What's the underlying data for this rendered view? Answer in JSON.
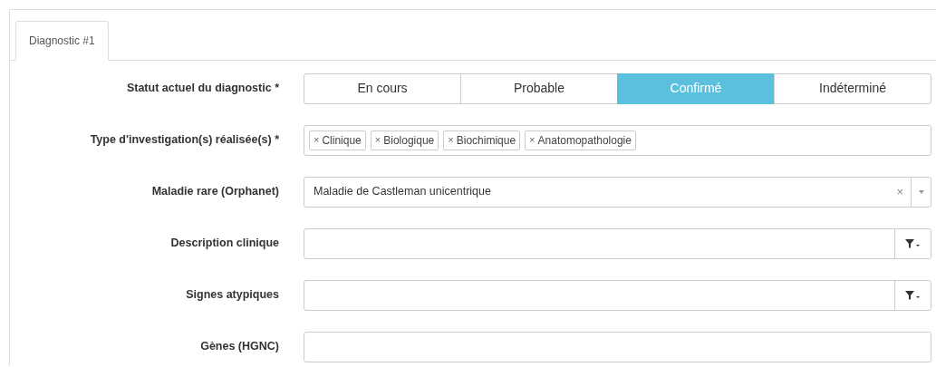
{
  "tabs": [
    {
      "label": "Diagnostic #1",
      "selected": true
    }
  ],
  "fields": [
    {
      "kind": "segmented",
      "label": "Statut actuel du diagnostic *",
      "options": [
        {
          "label": "En cours",
          "selected": false
        },
        {
          "label": "Probable",
          "selected": false
        },
        {
          "label": "Confirmé",
          "selected": true
        },
        {
          "label": "Indéterminé",
          "selected": false
        }
      ]
    },
    {
      "kind": "tags",
      "label": "Type d'investigation(s) réalisée(s) *",
      "tags": [
        {
          "remove": "×",
          "text": "Clinique"
        },
        {
          "remove": "×",
          "text": "Biologique"
        },
        {
          "remove": "×",
          "text": "Biochimique"
        },
        {
          "remove": "×",
          "text": "Anatomopathologie"
        }
      ]
    },
    {
      "kind": "select",
      "label": "Maladie rare (Orphanet)",
      "value": "Maladie de Castleman unicentrique",
      "clear": "×"
    },
    {
      "kind": "filter",
      "label": "Description clinique"
    },
    {
      "kind": "filter",
      "label": "Signes atypiques"
    },
    {
      "kind": "text",
      "label": "Gènes (HGNC)"
    }
  ]
}
